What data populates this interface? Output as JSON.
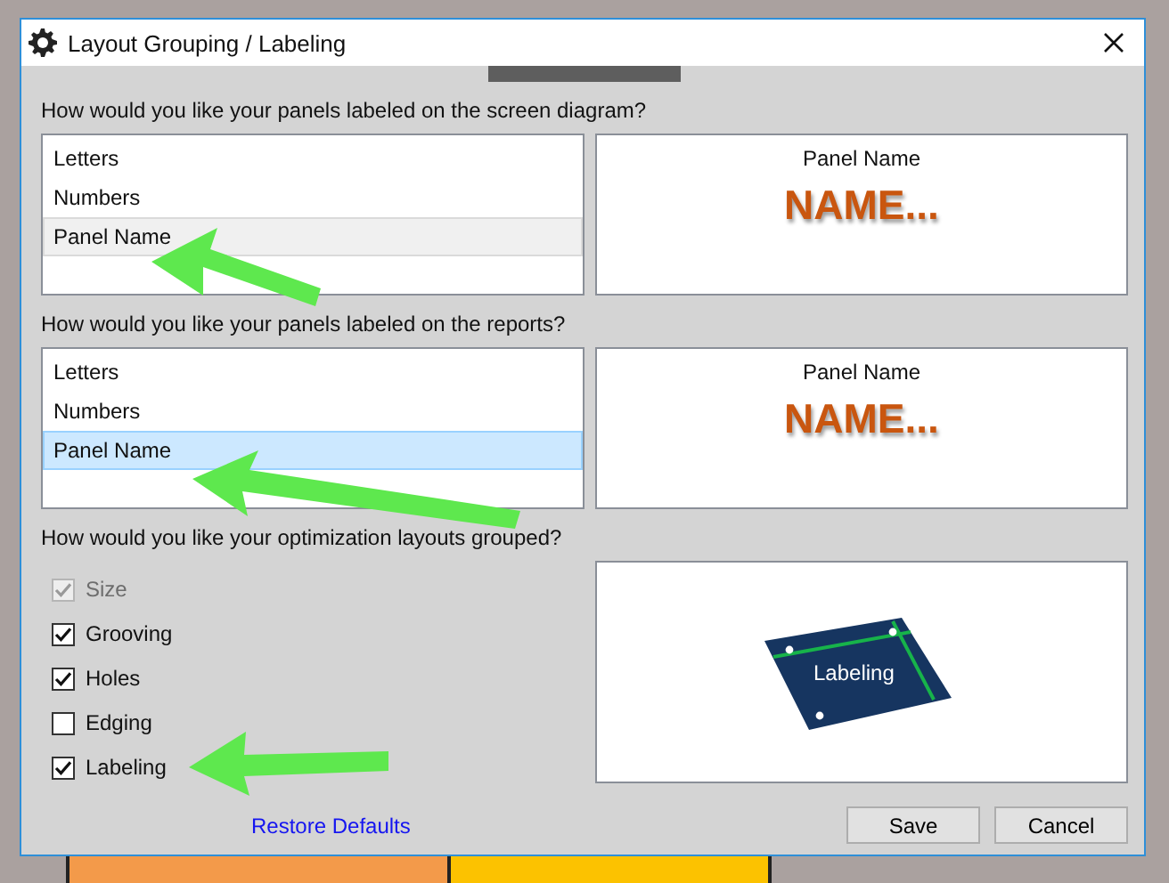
{
  "window": {
    "title": "Layout Grouping / Labeling"
  },
  "screen_labels": {
    "prompt": "How would you like your panels labeled on the screen diagram?",
    "focused": false,
    "options": [
      {
        "label": "Letters",
        "selected": false
      },
      {
        "label": "Numbers",
        "selected": false
      },
      {
        "label": "Panel Name",
        "selected": true
      }
    ],
    "preview": {
      "caption": "Panel Name",
      "sample": "NAME..."
    }
  },
  "report_labels": {
    "prompt": "How would you like your panels labeled on the reports?",
    "focused": true,
    "options": [
      {
        "label": "Letters",
        "selected": false
      },
      {
        "label": "Numbers",
        "selected": false
      },
      {
        "label": "Panel Name",
        "selected": true
      }
    ],
    "preview": {
      "caption": "Panel Name",
      "sample": "NAME..."
    }
  },
  "grouping": {
    "prompt": "How would you like your optimization layouts grouped?",
    "options": [
      {
        "label": "Size",
        "checked": true,
        "disabled": true
      },
      {
        "label": "Grooving",
        "checked": true,
        "disabled": false
      },
      {
        "label": "Holes",
        "checked": true,
        "disabled": false
      },
      {
        "label": "Edging",
        "checked": false,
        "disabled": false
      },
      {
        "label": "Labeling",
        "checked": true,
        "disabled": false
      }
    ],
    "preview": {
      "caption": "Labeling"
    }
  },
  "restore_link": "Restore Defaults",
  "buttons": [
    "Save",
    "Cancel"
  ]
}
